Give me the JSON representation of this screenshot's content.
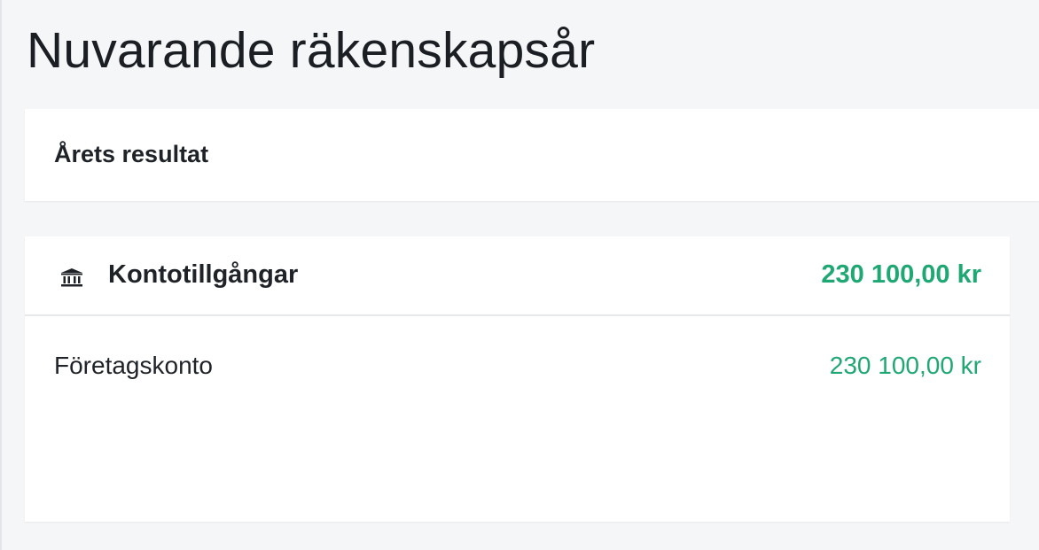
{
  "page": {
    "title": "Nuvarande räkenskapsår"
  },
  "result_card": {
    "heading": "Årets resultat"
  },
  "assets_card": {
    "icon": "bank-icon",
    "title": "Kontotillgångar",
    "total": "230 100,00 kr",
    "accounts": [
      {
        "name": "Företagskonto",
        "amount": "230 100,00 kr"
      }
    ]
  },
  "colors": {
    "positive_amount": "#1fa774",
    "background": "#f5f6f8",
    "card": "#ffffff",
    "text": "#1f2328"
  }
}
